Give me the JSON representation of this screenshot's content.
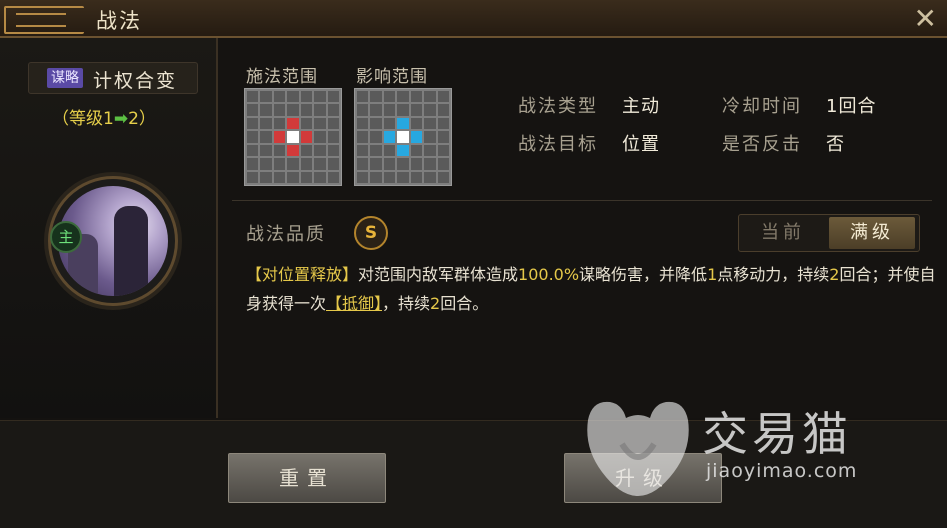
{
  "window": {
    "title": "战法",
    "close_icon": "close-icon"
  },
  "skill": {
    "tag": "谋略",
    "name": "计权合变",
    "level_from": "等级1",
    "level_to": "2",
    "main_badge": "主"
  },
  "ranges": {
    "cast_title": "施法范围",
    "effect_title": "影响范围",
    "cast_grid": [
      [
        0,
        0,
        0,
        0,
        0,
        0,
        0
      ],
      [
        0,
        0,
        0,
        0,
        0,
        0,
        0
      ],
      [
        0,
        0,
        0,
        1,
        0,
        0,
        0
      ],
      [
        0,
        0,
        1,
        2,
        1,
        0,
        0
      ],
      [
        0,
        0,
        0,
        1,
        0,
        0,
        0
      ],
      [
        0,
        0,
        0,
        0,
        0,
        0,
        0
      ],
      [
        0,
        0,
        0,
        0,
        0,
        0,
        0
      ]
    ],
    "effect_grid": [
      [
        0,
        0,
        0,
        0,
        0,
        0,
        0
      ],
      [
        0,
        0,
        0,
        0,
        0,
        0,
        0
      ],
      [
        0,
        0,
        0,
        3,
        0,
        0,
        0
      ],
      [
        0,
        0,
        3,
        2,
        3,
        0,
        0
      ],
      [
        0,
        0,
        0,
        3,
        0,
        0,
        0
      ],
      [
        0,
        0,
        0,
        0,
        0,
        0,
        0
      ],
      [
        0,
        0,
        0,
        0,
        0,
        0,
        0
      ]
    ]
  },
  "props": {
    "type_label": "战法类型",
    "type_value": "主动",
    "cooldown_label": "冷却时间",
    "cooldown_value": "1回合",
    "target_label": "战法目标",
    "target_value": "位置",
    "counter_label": "是否反击",
    "counter_value": "否"
  },
  "quality": {
    "label": "战法品质",
    "value": "S"
  },
  "toggle": {
    "current": "当前",
    "max": "满级"
  },
  "description": {
    "p1": "【对位置释放】",
    "p2": "对范围内敌军群体造成",
    "p3": "100.0%",
    "p4": "谋略伤害，并降低",
    "p5": "1",
    "p6": "点移动力，持续",
    "p7": "2",
    "p8": "回合；并使自身获得一次",
    "p9": "【抵御】",
    "p10": "，持续",
    "p11": "2",
    "p12": "回合。"
  },
  "buttons": {
    "reset": "重置",
    "upgrade": "升级"
  },
  "watermark": {
    "cn": "交易猫",
    "en": "jiaoyimao.com"
  },
  "colors": {
    "cast": "#d23a3a",
    "effect": "#27a8e0",
    "accent": "#e5c84a"
  }
}
